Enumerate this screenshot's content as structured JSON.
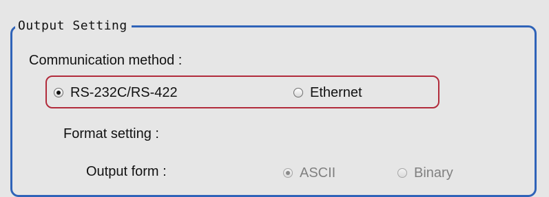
{
  "output_setting": {
    "title": "Output Setting",
    "communication_label": "Communication method :",
    "communication_options": [
      {
        "label": "RS-232C/RS-422",
        "selected": true
      },
      {
        "label": "Ethernet",
        "selected": false
      }
    ],
    "format_label": "Format setting :",
    "output_form_label": "Output form :",
    "output_form_options": [
      {
        "label": "ASCII",
        "selected": true,
        "enabled": false
      },
      {
        "label": "Binary",
        "selected": false,
        "enabled": false
      }
    ]
  },
  "colors": {
    "background": "#e6e6e6",
    "group_border": "#2f63b8",
    "highlight_border": "#b12a3a",
    "disabled_text": "#808080"
  }
}
